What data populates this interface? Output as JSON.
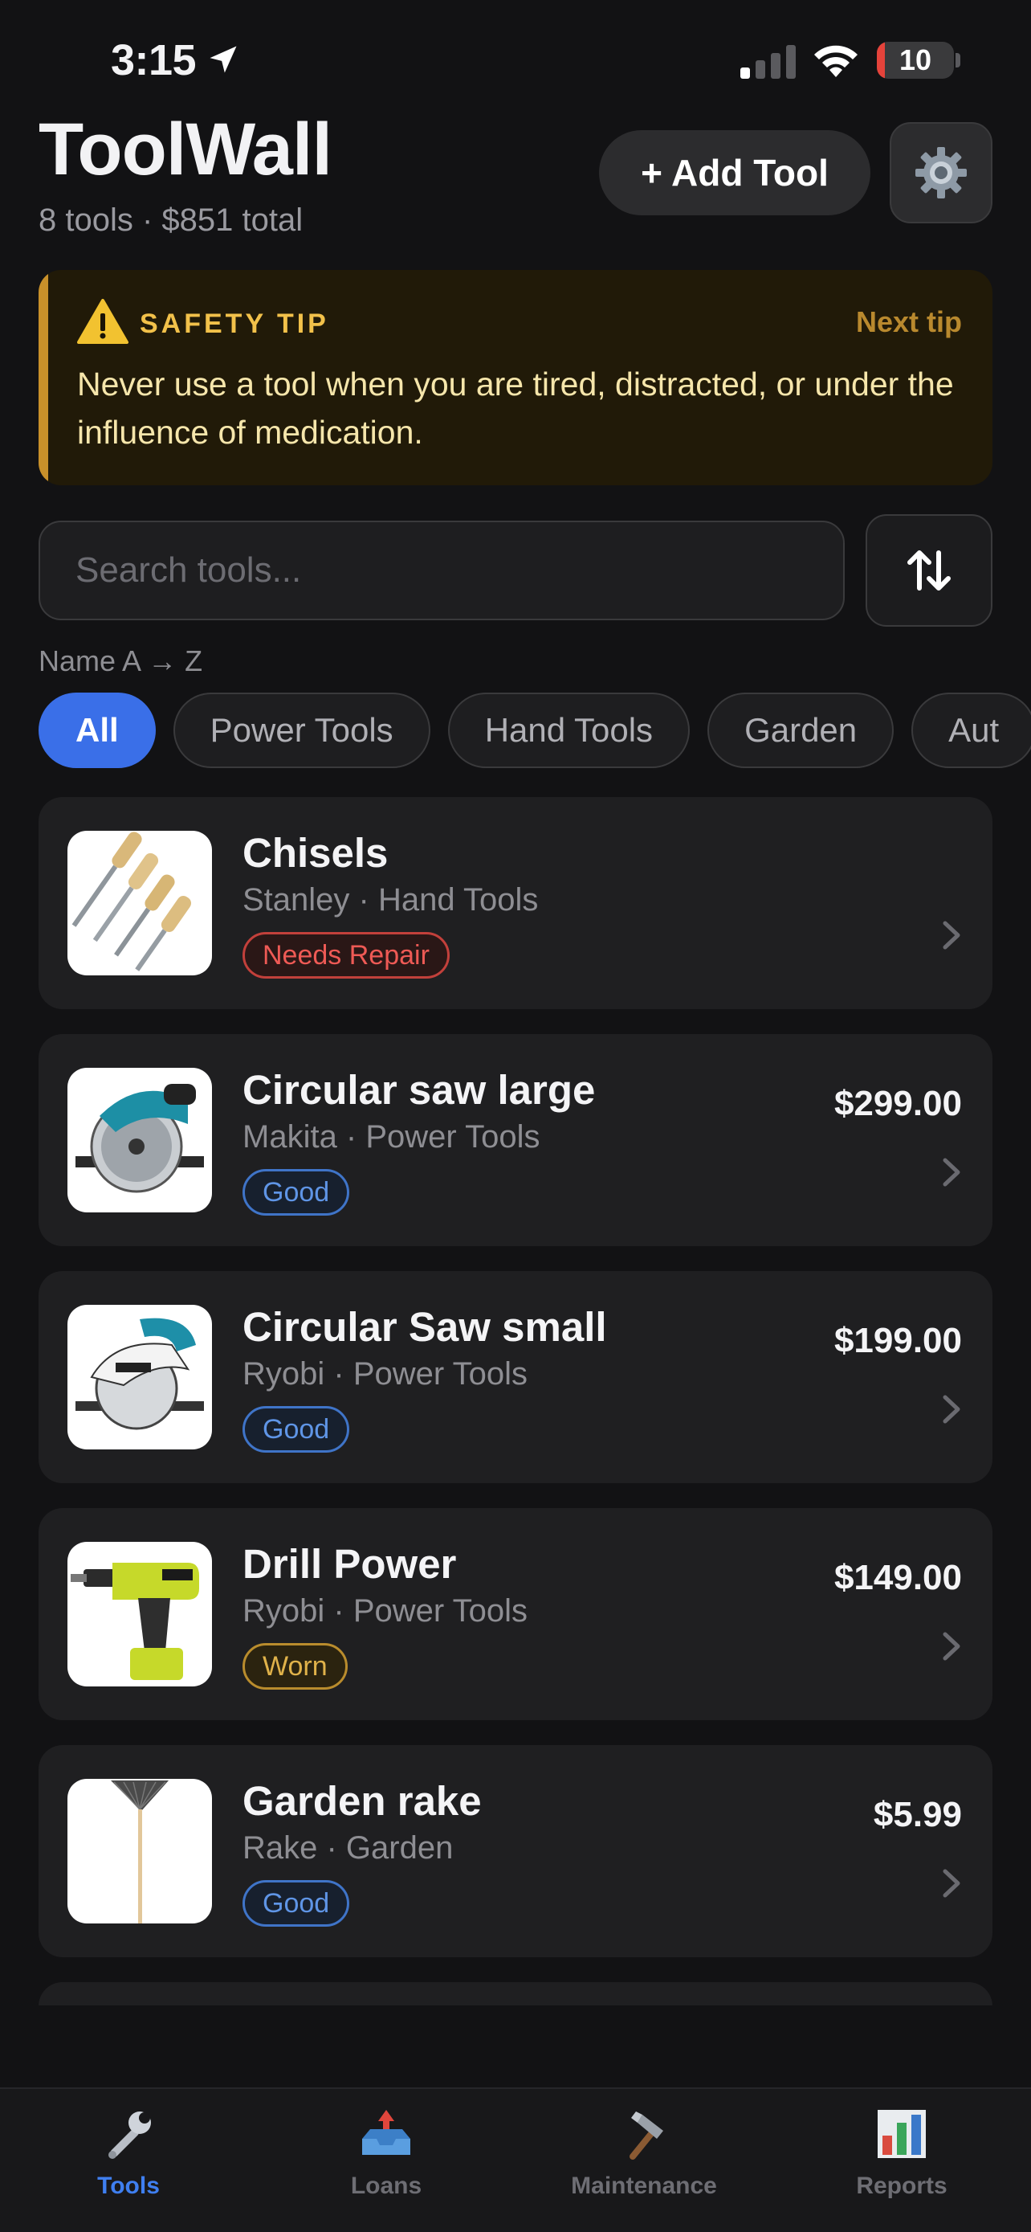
{
  "status_bar": {
    "time": "3:15",
    "battery": "10",
    "battery_level": 0.1
  },
  "header": {
    "title": "ToolWall",
    "subtitle": "8 tools · $851 total",
    "add_button": "+ Add Tool",
    "settings_icon": "gear-icon"
  },
  "safety_tip": {
    "title": "SAFETY TIP",
    "next": "Next tip",
    "text": "Never use a tool when you are tired, distracted, or under the influence of medication.",
    "icon": "warning-icon"
  },
  "search": {
    "placeholder": "Search tools...",
    "value": ""
  },
  "sort": {
    "label": "Name A → Z",
    "icon": "sort-icon"
  },
  "filters": [
    "All",
    "Power Tools",
    "Hand Tools",
    "Garden",
    "Aut"
  ],
  "active_filter": "All",
  "tools": [
    {
      "name": "Chisels",
      "meta": "Stanley · Hand Tools",
      "status": "Needs Repair",
      "status_type": "repair",
      "price": "",
      "image": "chisels"
    },
    {
      "name": "Circular saw large",
      "meta": "Makita · Power Tools",
      "status": "Good",
      "status_type": "good",
      "price": "$299.00",
      "image": "circular-saw-makita"
    },
    {
      "name": "Circular Saw small",
      "meta": "Ryobi · Power Tools",
      "status": "Good",
      "status_type": "good",
      "price": "$199.00",
      "image": "circular-saw-makita-white"
    },
    {
      "name": "Drill Power",
      "meta": "Ryobi · Power Tools",
      "status": "Worn",
      "status_type": "worn",
      "price": "$149.00",
      "image": "drill-ryobi"
    },
    {
      "name": "Garden rake",
      "meta": "Rake · Garden",
      "status": "Good",
      "status_type": "good",
      "price": "$5.99",
      "image": "rake"
    }
  ],
  "tabs": [
    {
      "label": "Tools",
      "icon": "wrench-icon",
      "active": true
    },
    {
      "label": "Loans",
      "icon": "inbox-tray-icon",
      "active": false
    },
    {
      "label": "Maintenance",
      "icon": "hammer-icon",
      "active": false
    },
    {
      "label": "Reports",
      "icon": "bar-chart-icon",
      "active": false
    }
  ],
  "colors": {
    "accent": "#3a6fe8",
    "tab_active": "#3f7ff0",
    "warning": "#f2c14a",
    "repair": "#ee5a55",
    "good": "#5f95e6",
    "worn": "#e0b24a"
  }
}
